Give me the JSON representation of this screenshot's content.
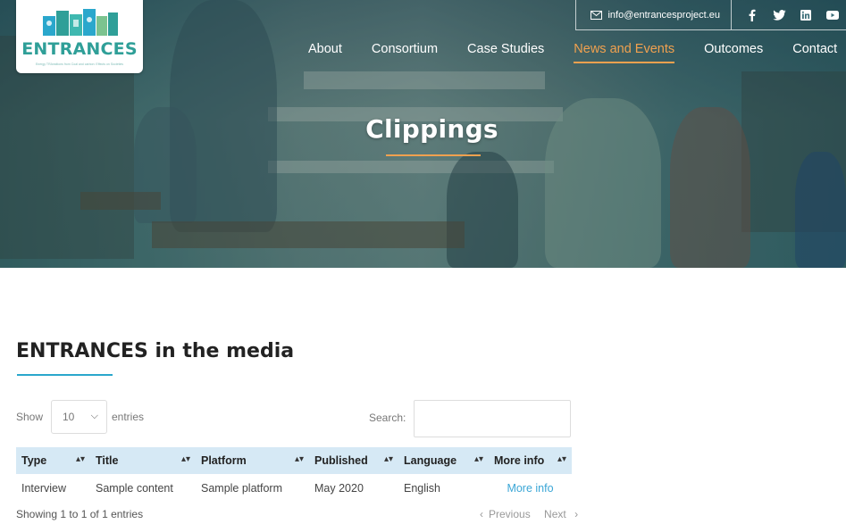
{
  "header": {
    "logo_text": "ENTRANCES",
    "logo_tagline": "Energy TRAnsitions from Coal and carbon: Effects on Societies",
    "email": "info@entrancesproject.eu",
    "socials": [
      "facebook-icon",
      "twitter-icon",
      "linkedin-icon",
      "youtube-icon"
    ],
    "nav": [
      "About",
      "Consortium",
      "Case Studies",
      "News and Events",
      "Outcomes",
      "Contact"
    ],
    "active_nav": "News and Events",
    "accent_color": "#f1a14f"
  },
  "hero": {
    "title": "Clippings"
  },
  "main": {
    "section_title": "ENTRANCES in the media",
    "underline_color": "#2aa7cc",
    "show_label": "Show",
    "page_length": "10",
    "entries_label": "entries",
    "search_label": "Search:",
    "search_value": "",
    "columns": [
      "Type",
      "Title",
      "Platform",
      "Published",
      "Language",
      "More info"
    ],
    "rows": [
      {
        "type": "Interview",
        "title": "Sample content",
        "platform": "Sample platform",
        "published": "May 2020",
        "language": "English",
        "more_info": "More info"
      }
    ],
    "info": "Showing 1 to 1 of 1 entries",
    "previous": "Previous",
    "next": "Next"
  }
}
